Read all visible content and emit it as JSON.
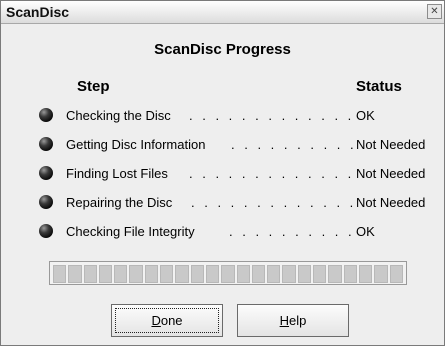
{
  "window": {
    "title": "ScanDisc",
    "close_glyph": "✕"
  },
  "heading": "ScanDisc Progress",
  "columns": {
    "step": "Step",
    "status": "Status"
  },
  "steps": [
    {
      "label": "Checking the Disc",
      "dots": ". . . . . . . . . . . . . . . . . .",
      "status": "OK",
      "indicator_icon": "led-icon"
    },
    {
      "label": "Getting Disc Information",
      "dots": ". . . . . . . . . . . . . . . .",
      "status": "Not Needed",
      "indicator_icon": "led-icon"
    },
    {
      "label": "Finding Lost Files",
      "dots": ". . . . . . . . . . . . . . . . . . .",
      "status": "Not Needed",
      "indicator_icon": "led-icon"
    },
    {
      "label": "Repairing the Disc",
      "dots": ". . . . . . . . . . . . . . . . . .",
      "status": "Not Needed",
      "indicator_icon": "led-icon"
    },
    {
      "label": "Checking File Integrity",
      "dots": ". . . . . . . . . . . . . . . .",
      "status": "OK",
      "indicator_icon": "led-icon"
    }
  ],
  "progress": {
    "fraction": 0.0,
    "segments": 23
  },
  "buttons": {
    "done": {
      "mnemonic": "D",
      "rest": "one"
    },
    "help": {
      "mnemonic": "H",
      "rest": "elp"
    }
  },
  "colors": {
    "face": "#eeeeee",
    "border": "#7a7a7a",
    "led": "#111111"
  }
}
